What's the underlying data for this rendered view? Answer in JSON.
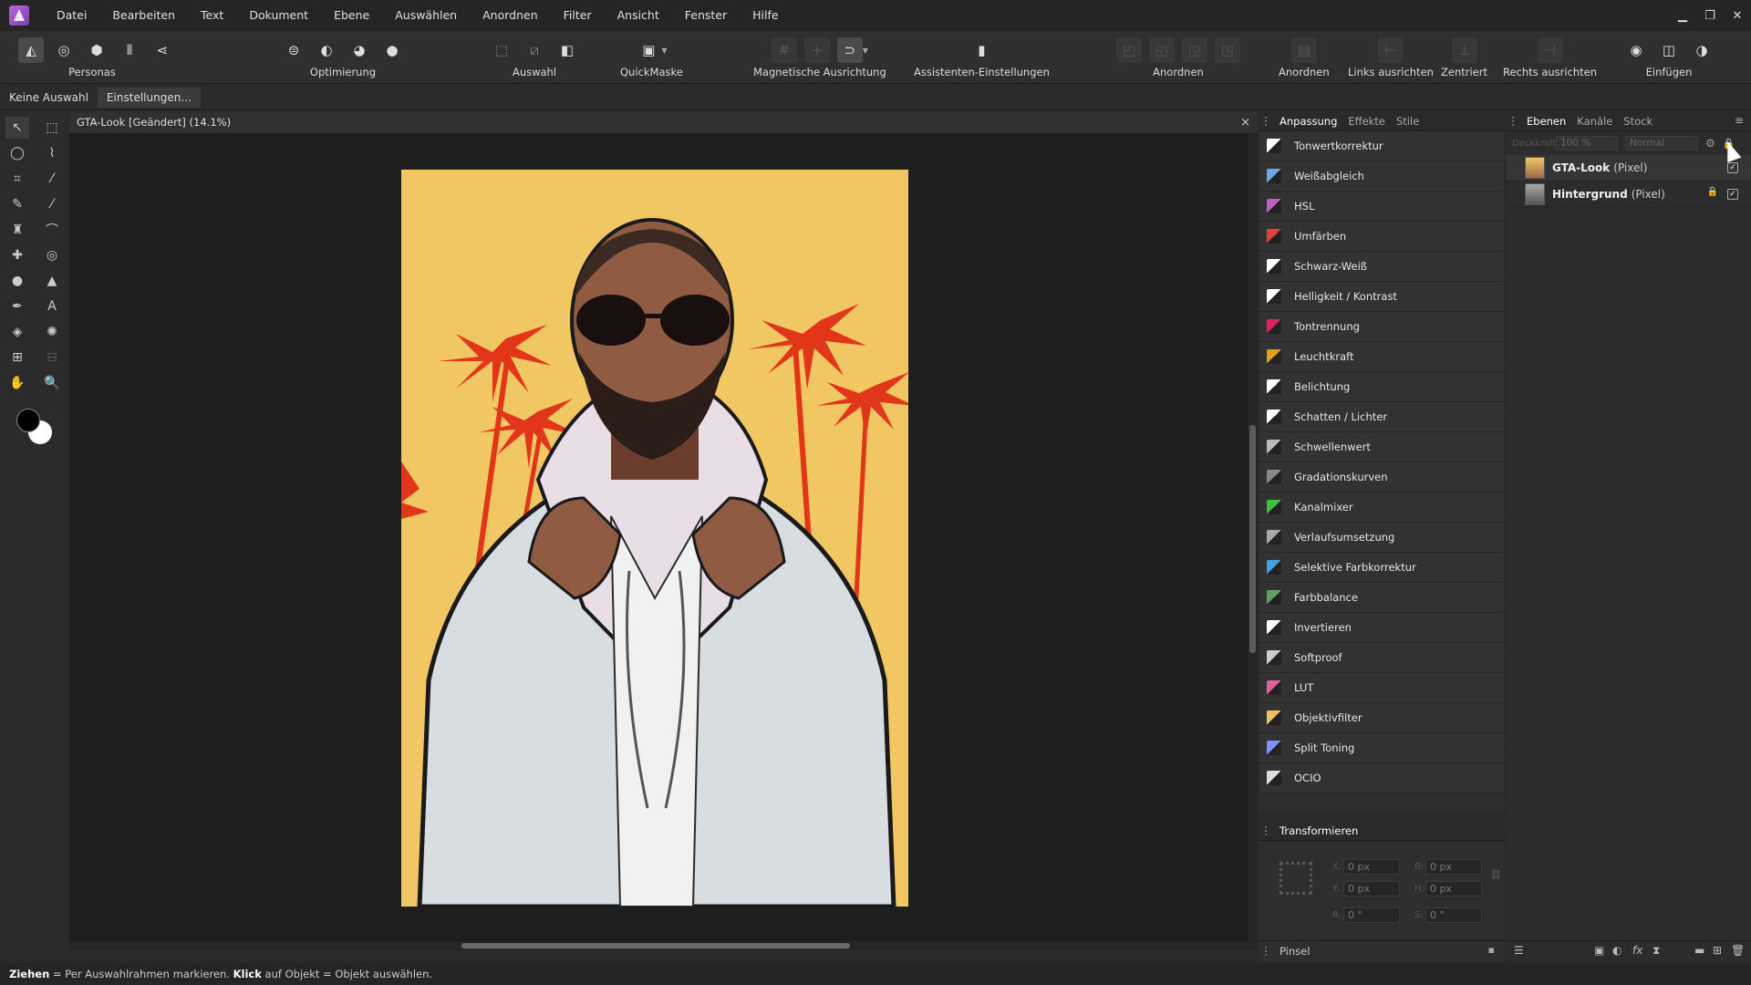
{
  "menu": {
    "items": [
      "Datei",
      "Bearbeiten",
      "Text",
      "Dokument",
      "Ebene",
      "Auswählen",
      "Anordnen",
      "Filter",
      "Ansicht",
      "Fenster",
      "Hilfe"
    ]
  },
  "toolbar": {
    "personas_label": "Personas",
    "optimierung_label": "Optimierung",
    "auswahl_label": "Auswahl",
    "quickmaske_label": "QuickMaske",
    "magnetische_label": "Magnetische Ausrichtung",
    "assistenten_label": "Assistenten-Einstellungen",
    "anordnen1_label": "Anordnen",
    "anordnen2_label": "Anordnen",
    "links_label": "Links ausrichten",
    "zentriert_label": "Zentriert",
    "rechts_label": "Rechts ausrichten",
    "einfuegen_label": "Einfügen"
  },
  "contextbar": {
    "no_selection": "Keine Auswahl",
    "settings": "Einstellungen..."
  },
  "document": {
    "title": "GTA-Look [Geändert] (14.1%)",
    "close": "×"
  },
  "adjust_panel": {
    "tabs": [
      "Anpassung",
      "Effekte",
      "Stile"
    ],
    "items": [
      {
        "label": "Tonwertkorrektur",
        "color": "#ffffff"
      },
      {
        "label": "Weißabgleich",
        "color": "#6fa8dc"
      },
      {
        "label": "HSL",
        "color": "#c060c0"
      },
      {
        "label": "Umfärben",
        "color": "#e04040"
      },
      {
        "label": "Schwarz-Weiß",
        "color": "#ffffff"
      },
      {
        "label": "Helligkeit / Kontrast",
        "color": "#ffffff"
      },
      {
        "label": "Tontrennung",
        "color": "#e02060"
      },
      {
        "label": "Leuchtkraft",
        "color": "#e0a020"
      },
      {
        "label": "Belichtung",
        "color": "#ffffff"
      },
      {
        "label": "Schatten / Lichter",
        "color": "#ffffff"
      },
      {
        "label": "Schwellenwert",
        "color": "#bbbbbb"
      },
      {
        "label": "Gradationskurven",
        "color": "#888888"
      },
      {
        "label": "Kanalmixer",
        "color": "#40c040"
      },
      {
        "label": "Verlaufsumsetzung",
        "color": "#aaaaaa"
      },
      {
        "label": "Selektive Farbkorrektur",
        "color": "#40a0e0"
      },
      {
        "label": "Farbbalance",
        "color": "#60a060"
      },
      {
        "label": "Invertieren",
        "color": "#ffffff"
      },
      {
        "label": "Softproof",
        "color": "#cccccc"
      },
      {
        "label": "LUT",
        "color": "#e060a0"
      },
      {
        "label": "Objektivfilter",
        "color": "#f0c060"
      },
      {
        "label": "Split Toning",
        "color": "#8090ff"
      },
      {
        "label": "OCIO",
        "color": "#dddddd"
      }
    ]
  },
  "transform_panel": {
    "title": "Transformieren",
    "x": "0 px",
    "y": "0 px",
    "w": "0 px",
    "h": "0 px",
    "r": "0 °",
    "s": "0 °"
  },
  "brush_panel": {
    "title": "Pinsel"
  },
  "layers_panel": {
    "tabs": [
      "Ebenen",
      "Kanäle",
      "Stock"
    ],
    "opacity": "100 %",
    "blend_mode": "Normal",
    "opacity_label": "Deckkraft:",
    "layers": [
      {
        "name": "GTA-Look",
        "type": "(Pixel)"
      },
      {
        "name": "Hintergrund",
        "type": "(Pixel)"
      }
    ]
  },
  "status": {
    "drag": "Ziehen",
    "drag_text": " = Per Auswahlrahmen markieren. ",
    "click": "Klick",
    "click_text": " auf Objekt = Objekt auswählen."
  },
  "colors": {
    "accent": "#7a3fb0",
    "photo_bg": "#f1c763",
    "palm": "#e2361a"
  }
}
